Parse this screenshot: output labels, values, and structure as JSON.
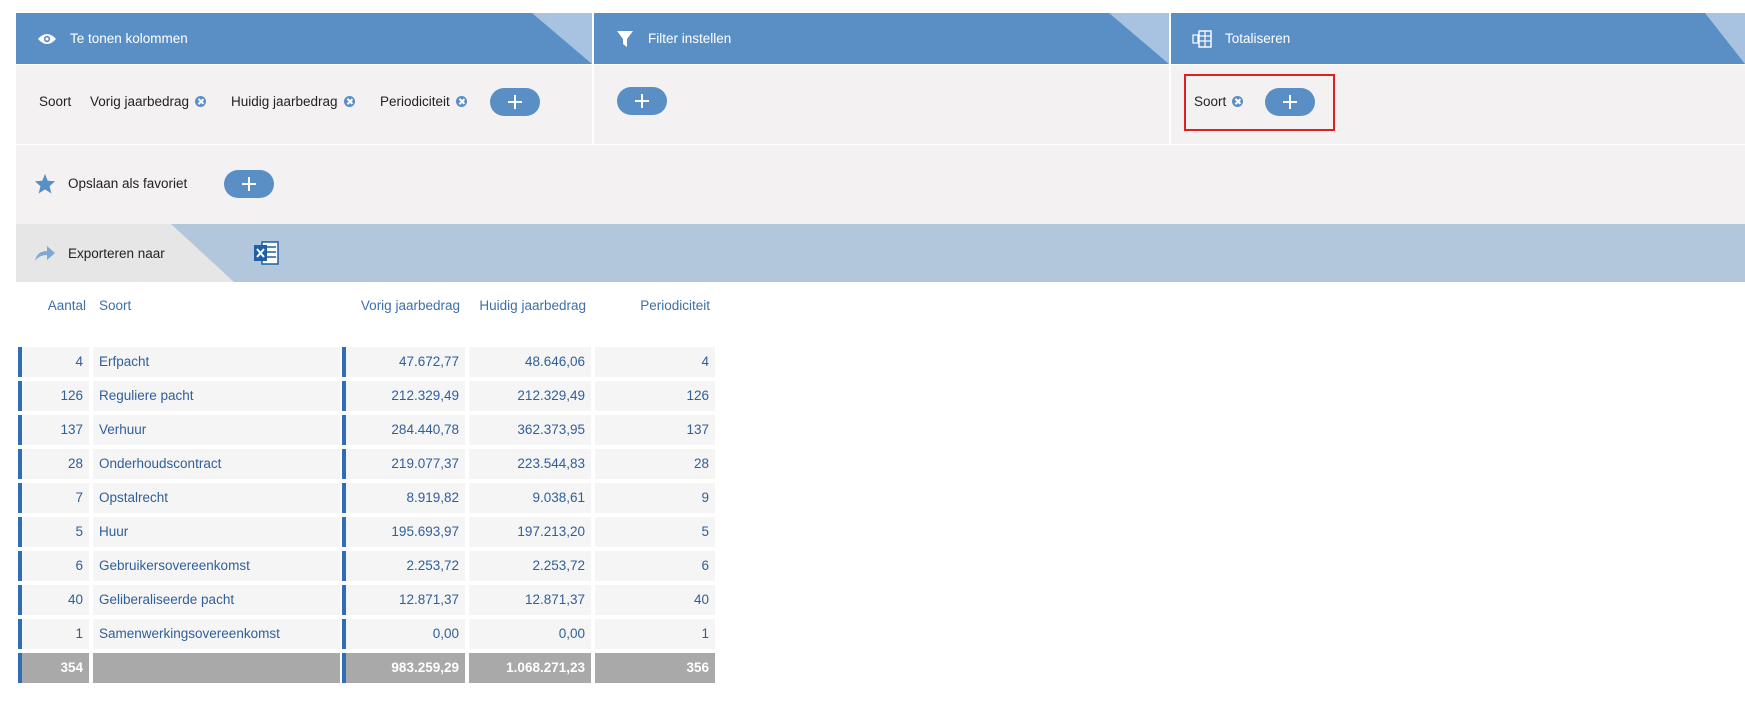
{
  "panels": {
    "columns": {
      "title": "Te tonen kolommen",
      "icon": "eye-icon",
      "chips": [
        "Soort",
        "Vorig jaarbedrag",
        "Huidig jaarbedrag",
        "Periodiciteit"
      ]
    },
    "filter": {
      "title": "Filter instellen",
      "icon": "filter-icon"
    },
    "totals": {
      "title": "Totaliseren",
      "icon": "totalize-icon",
      "chips": [
        "Soort"
      ]
    }
  },
  "favorite": {
    "label": "Opslaan als favoriet",
    "icon": "star-icon"
  },
  "export": {
    "label": "Exporteren naar",
    "icon": "share-arrow-icon",
    "target_icon": "excel-icon"
  },
  "table": {
    "headers": {
      "aantal": "Aantal",
      "soort": "Soort",
      "vorig": "Vorig jaarbedrag",
      "huidig": "Huidig jaarbedrag",
      "periodiciteit": "Periodiciteit"
    },
    "rows": [
      {
        "aantal": "4",
        "soort": "Erfpacht",
        "vorig": "47.672,77",
        "huidig": "48.646,06",
        "periodiciteit": "4"
      },
      {
        "aantal": "126",
        "soort": "Reguliere pacht",
        "vorig": "212.329,49",
        "huidig": "212.329,49",
        "periodiciteit": "126"
      },
      {
        "aantal": "137",
        "soort": "Verhuur",
        "vorig": "284.440,78",
        "huidig": "362.373,95",
        "periodiciteit": "137"
      },
      {
        "aantal": "28",
        "soort": "Onderhoudscontract",
        "vorig": "219.077,37",
        "huidig": "223.544,83",
        "periodiciteit": "28"
      },
      {
        "aantal": "7",
        "soort": "Opstalrecht",
        "vorig": "8.919,82",
        "huidig": "9.038,61",
        "periodiciteit": "9"
      },
      {
        "aantal": "5",
        "soort": "Huur",
        "vorig": "195.693,97",
        "huidig": "197.213,20",
        "periodiciteit": "5"
      },
      {
        "aantal": "6",
        "soort": "Gebruikersovereenkomst",
        "vorig": "2.253,72",
        "huidig": "2.253,72",
        "periodiciteit": "6"
      },
      {
        "aantal": "40",
        "soort": "Geliberaliseerde pacht",
        "vorig": "12.871,37",
        "huidig": "12.871,37",
        "periodiciteit": "40"
      },
      {
        "aantal": "1",
        "soort": "Samenwerkingsovereenkomst",
        "vorig": "0,00",
        "huidig": "0,00",
        "periodiciteit": "1"
      }
    ],
    "totals": {
      "aantal": "354",
      "soort": "",
      "vorig": "983.259,29",
      "huidig": "1.068.271,23",
      "periodiciteit": "356"
    }
  },
  "colors": {
    "accent": "#5a8fc6",
    "panel_bg": "#f3f1f2",
    "export_bar": "#b2c7dc",
    "highlight": "#e02020",
    "total_row": "#a9a9a9"
  }
}
